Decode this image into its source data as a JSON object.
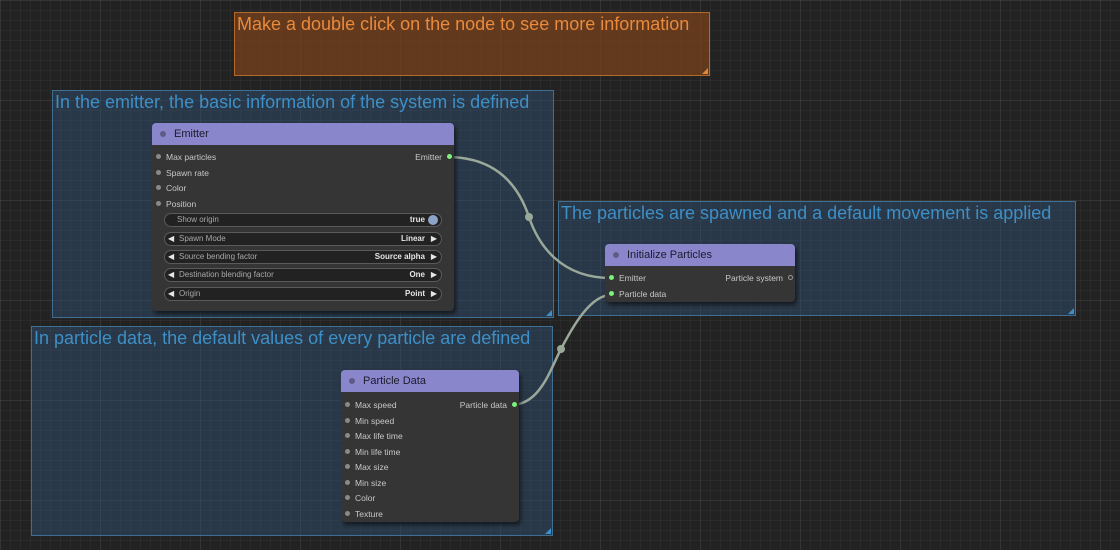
{
  "comment": {
    "text": "Make a double click on the node to see more information",
    "color": "#ea8a3c"
  },
  "groups": {
    "emitter": {
      "title": "In the emitter, the basic information of the system is defined"
    },
    "init": {
      "title": "The particles are spawned and a default movement is applied"
    },
    "particle": {
      "title": "In particle data, the default values of every particle are defined"
    }
  },
  "nodes": {
    "emitter": {
      "title": "Emitter",
      "inputs": [
        "Max particles",
        "Spawn rate",
        "Color",
        "Position"
      ],
      "output": "Emitter",
      "widgets": [
        {
          "label": "Show origin",
          "value": "true",
          "kind": "toggle"
        },
        {
          "label": "Spawn Mode",
          "value": "Linear",
          "kind": "combo"
        },
        {
          "label": "Source bending factor",
          "value": "Source alpha",
          "kind": "combo"
        },
        {
          "label": "Destination blending factor",
          "value": "One",
          "kind": "combo"
        },
        {
          "label": "Origin",
          "value": "Point",
          "kind": "combo"
        }
      ]
    },
    "init": {
      "title": "Initialize Particles",
      "inputs": [
        "Emitter",
        "Particle data"
      ],
      "output": "Particle system"
    },
    "particle": {
      "title": "Particle Data",
      "inputs": [
        "Max speed",
        "Min speed",
        "Max life time",
        "Min life time",
        "Max size",
        "Min size",
        "Color",
        "Texture"
      ],
      "output": "Particle data"
    }
  },
  "colors": {
    "node_title": "#8a86cc",
    "group_title": "#3d8fc7",
    "connected_slot": "#7cf27c",
    "link": "#9aa89a"
  },
  "icons": {
    "left_arrow": "◀",
    "right_arrow": "▶"
  }
}
